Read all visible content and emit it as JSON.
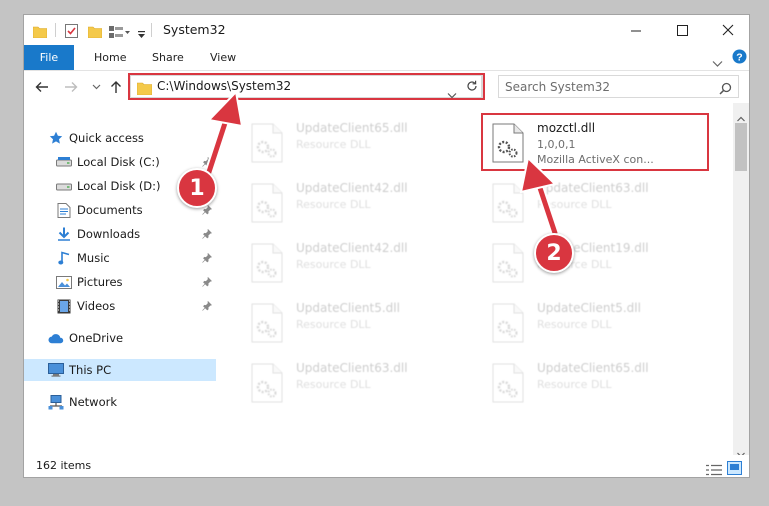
{
  "window": {
    "title": "System32"
  },
  "ribbon": {
    "tabs": [
      "File",
      "Home",
      "Share",
      "View"
    ]
  },
  "address": {
    "path": "C:\\Windows\\System32"
  },
  "search": {
    "placeholder": "Search System32"
  },
  "nav_pane": {
    "items": [
      {
        "label": "Quick access",
        "icon": "star-icon",
        "pinned": false
      },
      {
        "label": "Local Disk (C:)",
        "icon": "drive-icon",
        "pinned": true
      },
      {
        "label": "Local Disk (D:)",
        "icon": "drive-icon",
        "pinned": false
      },
      {
        "label": "Documents",
        "icon": "documents-icon",
        "pinned": true
      },
      {
        "label": "Downloads",
        "icon": "downloads-icon",
        "pinned": true
      },
      {
        "label": "Music",
        "icon": "music-icon",
        "pinned": true
      },
      {
        "label": "Pictures",
        "icon": "pictures-icon",
        "pinned": true
      },
      {
        "label": "Videos",
        "icon": "videos-icon",
        "pinned": true
      },
      {
        "label": "OneDrive",
        "icon": "cloud-icon",
        "pinned": false
      },
      {
        "label": "This PC",
        "icon": "computer-icon",
        "pinned": false,
        "selected": true
      },
      {
        "label": "Network",
        "icon": "network-icon",
        "pinned": false
      }
    ]
  },
  "files": [
    {
      "name": "UpdateClient65.dll",
      "type": "Resource DLL"
    },
    {
      "name": "mozctl.dll",
      "type": "1,0,0,1",
      "description": "Mozilla ActiveX con..."
    },
    {
      "name": "UpdateClient42.dll",
      "type": "Resource DLL"
    },
    {
      "name": "UpdateClient63.dll",
      "type": "Resource DLL"
    },
    {
      "name": "UpdateClient42.dll",
      "type": "Resource DLL"
    },
    {
      "name": "UpdateClient19.dll",
      "type": "Resource DLL"
    },
    {
      "name": "UpdateClient5.dll",
      "type": "Resource DLL"
    },
    {
      "name": "UpdateClient5.dll",
      "type": "Resource DLL"
    },
    {
      "name": "UpdateClient63.dll",
      "type": "Resource DLL"
    },
    {
      "name": "UpdateClient65.dll",
      "type": "Resource DLL"
    }
  ],
  "status": {
    "item_count": "162 items"
  },
  "annotations": {
    "step1": "1",
    "step2": "2"
  },
  "colors": {
    "accent": "#1979ca",
    "highlight": "#d93640",
    "selection": "#cce8ff"
  }
}
